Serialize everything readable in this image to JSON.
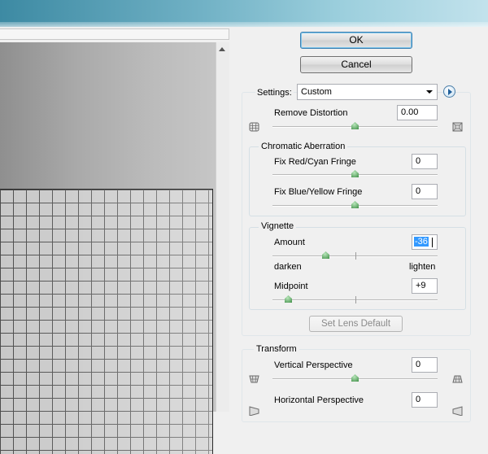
{
  "buttons": {
    "ok": "OK",
    "cancel": "Cancel",
    "set_lens_default": "Set Lens Default"
  },
  "settings": {
    "label": "Settings:",
    "value": "Custom"
  },
  "remove_distortion": {
    "label": "Remove Distortion",
    "value": "0.00",
    "slider_position": 0.5
  },
  "chromatic_aberration": {
    "title": "Chromatic Aberration",
    "red_cyan": {
      "label": "Fix Red/Cyan Fringe",
      "value": "0",
      "slider_position": 0.5
    },
    "blue_yellow": {
      "label": "Fix Blue/Yellow Fringe",
      "value": "0",
      "slider_position": 0.5
    }
  },
  "vignette": {
    "title": "Vignette",
    "amount": {
      "label": "Amount",
      "value": "-36",
      "slider_position": 0.32
    },
    "darken_label": "darken",
    "lighten_label": "lighten",
    "midpoint": {
      "label": "Midpoint",
      "value": "+9",
      "slider_position": 0.09
    }
  },
  "transform": {
    "title": "Transform",
    "vertical": {
      "label": "Vertical Perspective",
      "value": "0",
      "slider_position": 0.5
    },
    "horizontal": {
      "label": "Horizontal Perspective",
      "value": "0"
    }
  },
  "icons": {
    "distortion_left": "pincushion-grid-icon",
    "distortion_right": "barrel-grid-icon",
    "settings_menu": "flyout-menu-icon",
    "vertical_left": "perspective-narrow-icon",
    "vertical_right": "perspective-wide-icon"
  },
  "colors": {
    "selection": "#3399ff",
    "slider_thumb": "#3f8f47",
    "default_button_border": "#3c7fb1"
  }
}
